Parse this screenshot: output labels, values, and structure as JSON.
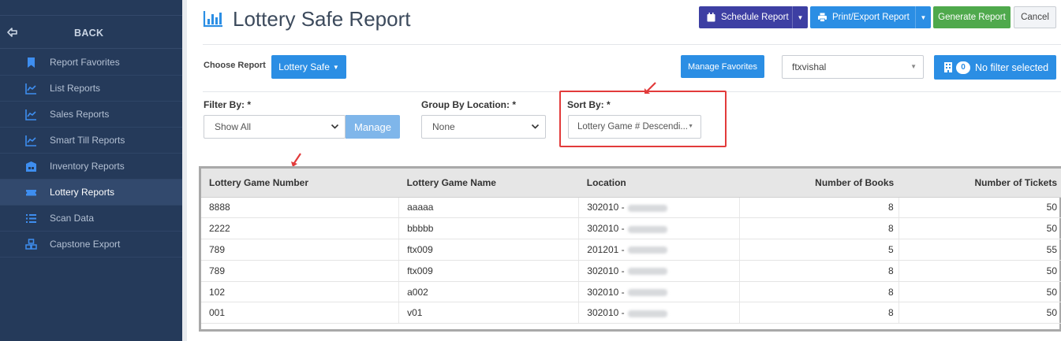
{
  "sidebar": {
    "back_label": "BACK",
    "items": [
      {
        "label": "Report Favorites",
        "icon": "bookmark-icon",
        "active": false
      },
      {
        "label": "List Reports",
        "icon": "line-chart-icon",
        "active": false
      },
      {
        "label": "Sales Reports",
        "icon": "line-chart-icon",
        "active": false
      },
      {
        "label": "Smart Till Reports",
        "icon": "line-chart-icon",
        "active": false
      },
      {
        "label": "Inventory Reports",
        "icon": "warehouse-icon",
        "active": false
      },
      {
        "label": "Lottery Reports",
        "icon": "ticket-icon",
        "active": true
      },
      {
        "label": "Scan Data",
        "icon": "list-icon",
        "active": false
      },
      {
        "label": "Capstone Export",
        "icon": "boxes-icon",
        "active": false
      }
    ]
  },
  "header": {
    "title": "Lottery Safe Report",
    "schedule_label": "Schedule Report",
    "print_label": "Print/Export Report",
    "generate_label": "Generate Report",
    "cancel_label": "Cancel"
  },
  "report_row": {
    "choose_label": "Choose Report",
    "choose_value": "Lottery Safe",
    "favorites_label": "Manage Favorites",
    "user_value": "ftxvishal",
    "filter_count": "0",
    "filter_label": "No filter selected"
  },
  "filters": {
    "filter_by_label": "Filter By: *",
    "filter_by_value": "Show All",
    "manage_label": "Manage",
    "group_label": "Group By Location: *",
    "group_value": "None",
    "sort_label": "Sort By: *",
    "sort_value": "Lottery Game # Descendi..."
  },
  "table": {
    "columns": [
      "Lottery Game Number",
      "Lottery Game Name",
      "Location",
      "Number of Books",
      "Number of Tickets"
    ],
    "rows": [
      {
        "game_number": "8888",
        "game_name": "aaaaa",
        "location": "302010 -",
        "books": "8",
        "tickets": "50"
      },
      {
        "game_number": "2222",
        "game_name": "bbbbb",
        "location": "302010 -",
        "books": "8",
        "tickets": "50"
      },
      {
        "game_number": "789",
        "game_name": "ftx009",
        "location": "201201 -",
        "books": "5",
        "tickets": "55"
      },
      {
        "game_number": "789",
        "game_name": "ftx009",
        "location": "302010 -",
        "books": "8",
        "tickets": "50"
      },
      {
        "game_number": "102",
        "game_name": "a002",
        "location": "302010 -",
        "books": "8",
        "tickets": "50"
      },
      {
        "game_number": "001",
        "game_name": "v01",
        "location": "302010 -",
        "books": "8",
        "tickets": "50"
      }
    ]
  },
  "colors": {
    "sidebar_bg": "#253a5a",
    "primary": "#2b8ee4",
    "schedule": "#3d3fa3",
    "generate": "#4fa94c",
    "annotation": "#e23b3b"
  }
}
